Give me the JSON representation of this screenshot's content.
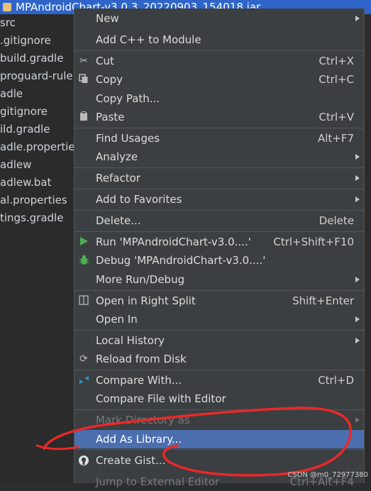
{
  "tree": {
    "header": "MPAndroidChart-v3.0.3_20220903_154018.jar",
    "rows": [
      "src",
      ".gitignore",
      "build.gradle",
      "proguard-rule",
      "adle",
      "gitignore",
      "ild.gradle",
      "adle.properties",
      "adlew",
      "adlew.bat",
      "al.properties",
      "tings.gradle"
    ]
  },
  "menu": {
    "new": "New",
    "add_cpp": "Add C++ to Module",
    "cut": "Cut",
    "cut_sc": "Ctrl+X",
    "copy": "Copy",
    "copy_sc": "Ctrl+C",
    "copy_path": "Copy Path...",
    "paste": "Paste",
    "paste_sc": "Ctrl+V",
    "find_usages": "Find Usages",
    "find_usages_sc": "Alt+F7",
    "analyze": "Analyze",
    "refactor": "Refactor",
    "add_favorites": "Add to Favorites",
    "delete": "Delete...",
    "delete_sc": "Delete",
    "run": "Run 'MPAndroidChart-v3.0....'",
    "run_sc": "Ctrl+Shift+F10",
    "debug": "Debug 'MPAndroidChart-v3.0....'",
    "more_run": "More Run/Debug",
    "open_right": "Open in Right Split",
    "open_right_sc": "Shift+Enter",
    "open_in": "Open In",
    "local_history": "Local History",
    "reload": "Reload from Disk",
    "compare_with": "Compare With...",
    "compare_with_sc": "Ctrl+D",
    "compare_editor": "Compare File with Editor",
    "mark_dir": "Mark Directory as",
    "add_library": "Add As Library...",
    "create_gist": "Create Gist...",
    "jump_external": "Jump to External Editor",
    "jump_external_sc": "Ctrl+Alt+F4"
  },
  "watermark": "CSDN @m0_72977380",
  "colors": {
    "selected": "#4b6eaf",
    "annotation": "#e8292a",
    "run_green": "#4caf50",
    "compare_blue": "#3592c4"
  }
}
